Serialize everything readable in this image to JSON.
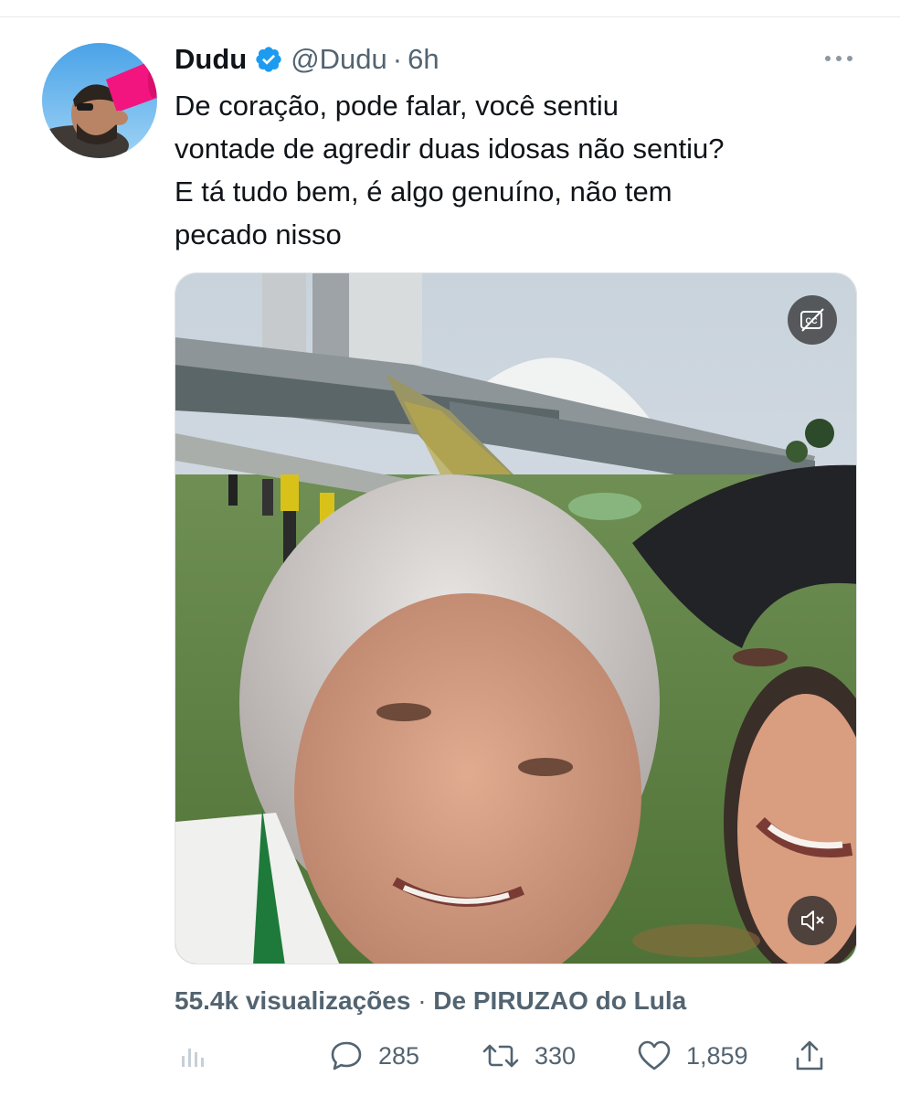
{
  "tweet": {
    "author": {
      "display_name": "Dudu",
      "verified": true,
      "handle": "@Dudu",
      "separator": "·",
      "time": "6h",
      "avatar_icon": "avatar-person-drinking"
    },
    "text": "De coração, pode falar, você sentiu\nvontade de agredir duas idosas não sentiu?\nE tá tudo bem, é algo genuíno, não tem\npecado nisso",
    "media": {
      "type": "video",
      "captions_icon": "captions-off-icon",
      "mute_icon": "speaker-muted-icon"
    },
    "views": "55.4k visualizações",
    "meta_separator": "·",
    "source": "De PIRUZAO do Lula",
    "actions": {
      "analytics_icon": "analytics-icon",
      "replies": "285",
      "retweets": "330",
      "likes": "1,859",
      "share_icon": "share-icon"
    },
    "colors": {
      "text": "#0f1419",
      "secondary": "#536471",
      "verified": "#1d9bf0",
      "divider": "#e6e9eb"
    }
  }
}
